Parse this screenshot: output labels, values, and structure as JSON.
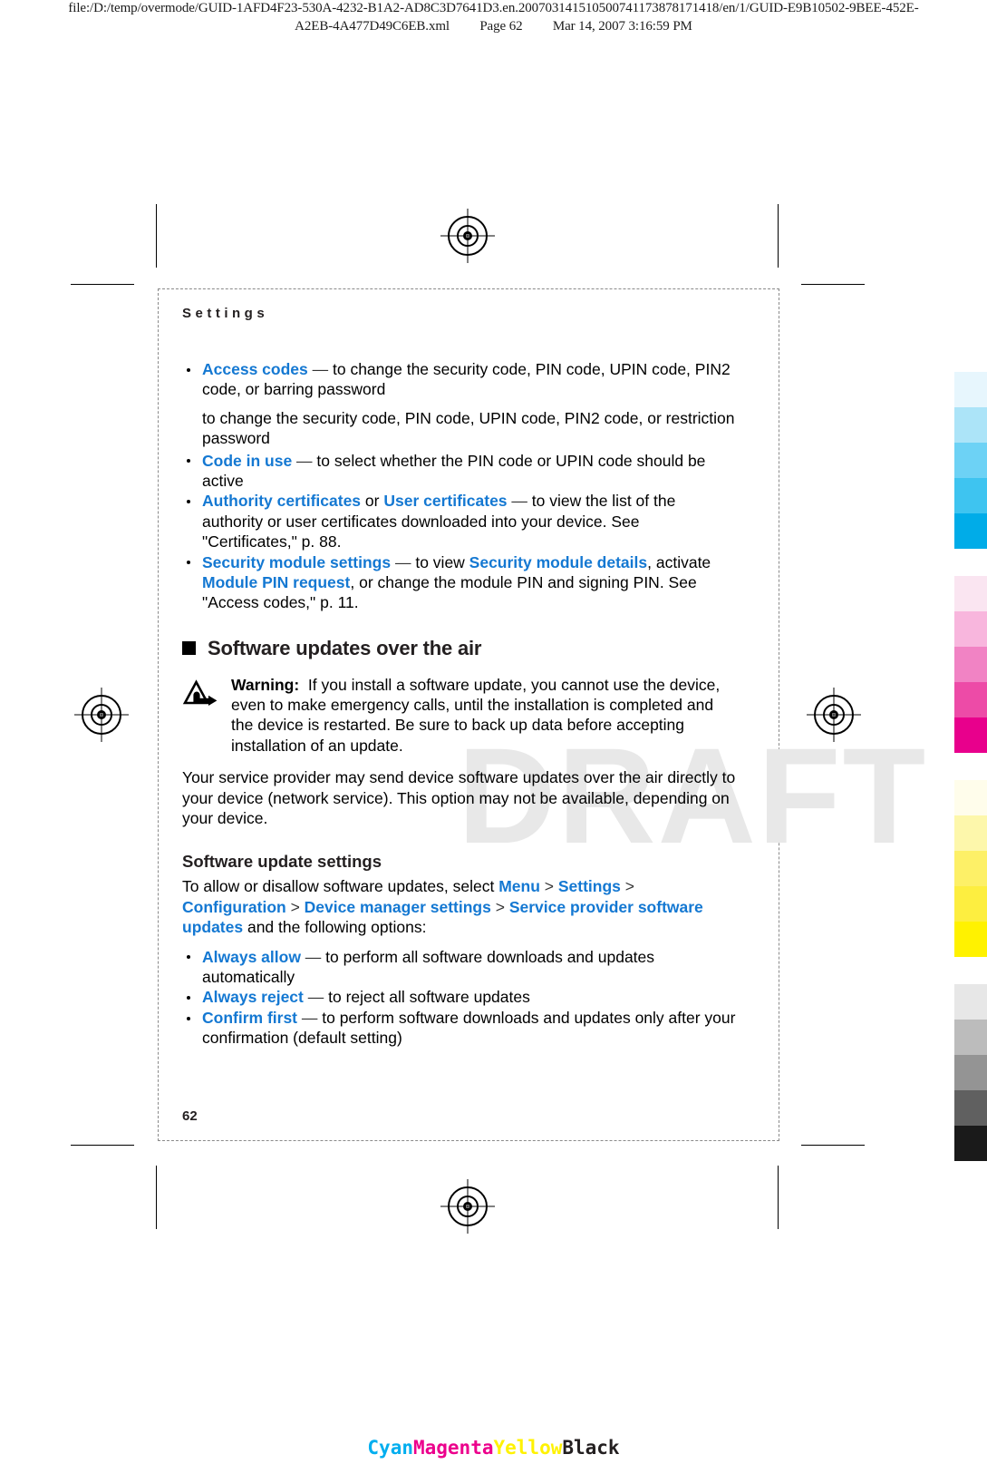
{
  "print_header": {
    "file_path_line1": "file:/D:/temp/overmode/GUID-1AFD4F23-530A-4232-B1A2-AD8C3D7641D3.en.200703141510500741173878171418/en/1/GUID-E9B10502-9BEE-452E-",
    "file_path_line2": "A2EB-4A477D49C6EB.xml",
    "page_label": "Page 62",
    "timestamp": "Mar 14, 2007 3:16:59 PM"
  },
  "watermark": "DRAFT",
  "document": {
    "running_head": "Settings",
    "page_number": "62",
    "bullets_top": [
      {
        "term": "Access codes",
        "dash": " — ",
        "rest": "to change the security code, PIN code, UPIN code, PIN2 code, or barring password"
      }
    ],
    "orphan_note": "to change the security code, PIN code, UPIN code, PIN2 code, or restriction password",
    "bullet_code_in_use": {
      "term": "Code in use",
      "dash": " — ",
      "rest": "to select whether the PIN code or UPIN code should be active"
    },
    "bullet_certificates": {
      "term1": "Authority certificates",
      "conj": " or ",
      "term2": "User certificates",
      "dash": " — ",
      "rest": "to view the list of the authority or user certificates downloaded into your device. See \"Certificates,\" p. 88."
    },
    "bullet_security_module": {
      "term1": "Security module settings",
      "dash": " — ",
      "mid1": "to view ",
      "term2": "Security module details",
      "mid2": ", activate ",
      "term3": "Module PIN request",
      "rest": ", or change the module PIN and signing PIN. See \"Access codes,\" p. 11."
    },
    "section_heading": "Software updates over the air",
    "warning": {
      "label": "Warning:",
      "text": "If you install a software update, you cannot use the device, even to make emergency calls, until the installation is completed and the device is restarted. Be sure to back up data before accepting installation of an update."
    },
    "intro_paragraph": "Your service provider may send device software updates over the air directly to your device (network service). This option may not be available, depending on your device.",
    "subsection_heading": "Software update settings",
    "path_sentence": {
      "lead": "To allow or disallow software updates, select ",
      "steps": [
        "Menu",
        "Settings",
        "Configuration",
        "Device manager settings",
        "Service provider software updates"
      ],
      "separator": " > ",
      "tail": " and the following options:"
    },
    "bullets_options": [
      {
        "term": "Always allow",
        "dash": " — ",
        "rest": "to perform all software downloads and updates automatically"
      },
      {
        "term": "Always reject",
        "dash": " — ",
        "rest": "to reject all software updates"
      },
      {
        "term": "Confirm first",
        "dash": " — ",
        "rest": "to perform software downloads and updates only after your confirmation (default setting)"
      }
    ]
  },
  "color_bars": {
    "groups": [
      {
        "name": "cyan",
        "swatches": [
          "#e7f6fd",
          "#ace4f8",
          "#6dd2f5",
          "#3ec4f0",
          "#00ace8"
        ]
      },
      {
        "name": "magenta",
        "swatches": [
          "#fae5f1",
          "#f8b6dd",
          "#f183c4",
          "#ed4ba7",
          "#e8008c"
        ]
      },
      {
        "name": "yellow",
        "swatches": [
          "#fffdeb",
          "#fdf7ab",
          "#fdf067",
          "#fdee40",
          "#fff200"
        ]
      },
      {
        "name": "black",
        "swatches": [
          "#e7e7e7",
          "#bcbcbc",
          "#949494",
          "#606060",
          "#1a1a1a"
        ]
      }
    ]
  },
  "cmyk_footer": {
    "labels": [
      {
        "text": "Cyan",
        "color": "#00aeef"
      },
      {
        "text": "Magenta",
        "color": "#ec008c"
      },
      {
        "text": "Yellow",
        "color": "#fff200"
      },
      {
        "text": "Black",
        "color": "#231f20"
      }
    ]
  }
}
